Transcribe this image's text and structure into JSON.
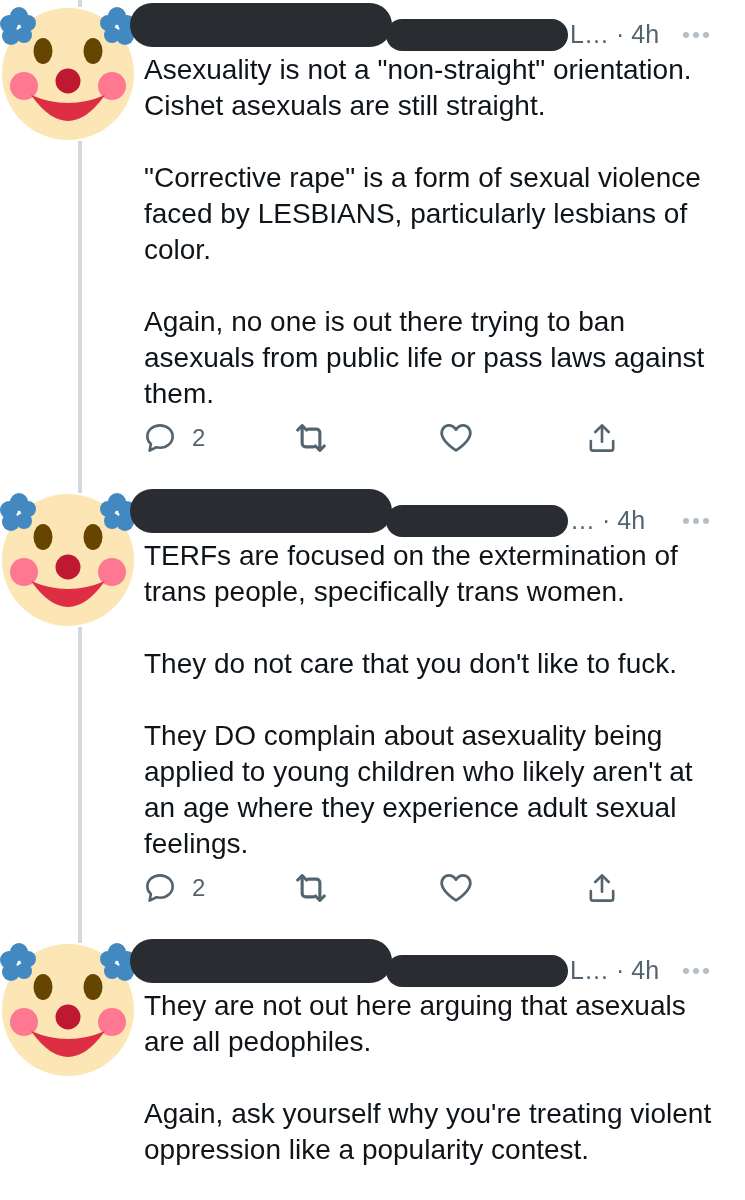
{
  "thread": {
    "continues_above": true
  },
  "tweets": [
    {
      "handle": "L…",
      "separator": "·",
      "time": "4h",
      "thread_line": true,
      "paragraphs": [
        "Asexuality is not a \"non-straight\" orientation.\nCishet asexuals are still straight.",
        "\"Corrective rape\" is a form of sexual violence\nfaced by LESBIANS, particularly lesbians of\ncolor.",
        "Again, no one is out there trying to ban\nasexuals from public life or pass laws against\nthem."
      ],
      "actions": [
        {
          "kind": "reply",
          "count": "2"
        },
        {
          "kind": "retweet"
        },
        {
          "kind": "like"
        },
        {
          "kind": "share"
        }
      ]
    },
    {
      "handle": "…",
      "separator": "·",
      "time": "4h",
      "thread_line": true,
      "paragraphs": [
        "TERFs are focused on the extermination of\ntrans people, specifically trans women.",
        "They do not care that you don't like to fuck.",
        "They DO complain about asexuality being\napplied to young children who likely aren't at\nan age where they experience adult sexual\nfeelings."
      ],
      "actions": [
        {
          "kind": "reply",
          "count": "2"
        },
        {
          "kind": "retweet"
        },
        {
          "kind": "like"
        },
        {
          "kind": "share"
        }
      ]
    },
    {
      "handle": "L…",
      "separator": "·",
      "time": "4h",
      "thread_line": false,
      "paragraphs": [
        "They are not out here arguing that asexuals\nare all pedophiles.",
        "Again, ask yourself why you're treating violent\noppression like a popularity contest."
      ]
    }
  ]
}
